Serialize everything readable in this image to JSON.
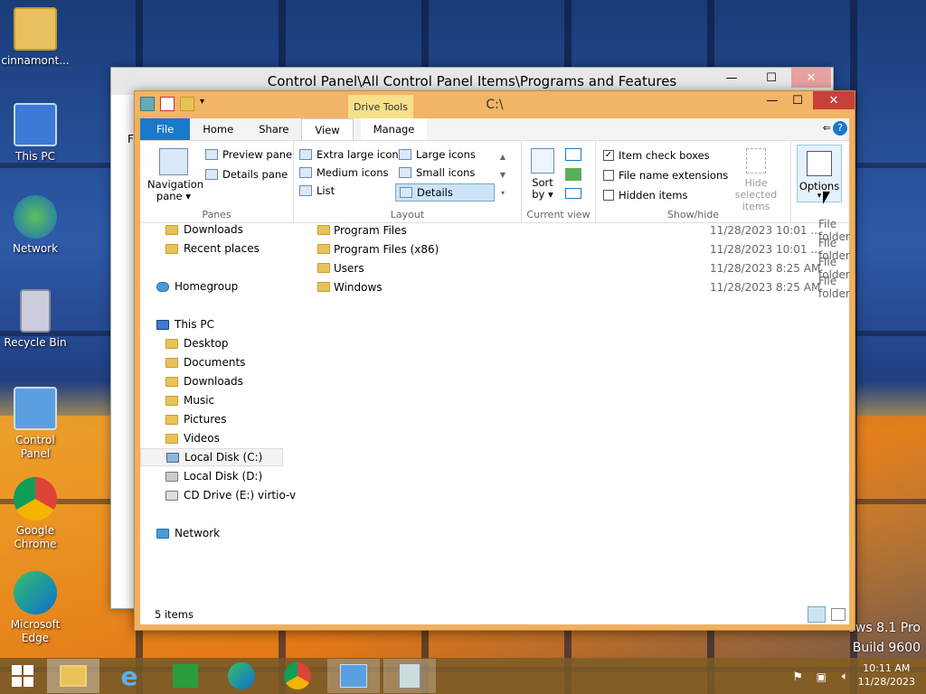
{
  "desktop": {
    "icons": [
      {
        "label": "cinnamont..."
      },
      {
        "label": "This PC"
      },
      {
        "label": "Network"
      },
      {
        "label": "Recycle Bin"
      },
      {
        "label": "Control Panel"
      },
      {
        "label": "Google Chrome"
      },
      {
        "label": "Microsoft Edge"
      }
    ],
    "watermark_line1": "ows 8.1 Pro",
    "watermark_line2": "Build 9600"
  },
  "back_window": {
    "title": "Control Panel\\All Control Panel Items\\Programs and Features",
    "left_letter": "Fi"
  },
  "window": {
    "title": "C:\\",
    "context_tab": "Drive Tools",
    "tabs": [
      "File",
      "Home",
      "Share",
      "View",
      "Manage"
    ],
    "ribbon": {
      "panes": {
        "nav_line1": "Navigation",
        "nav_line2": "pane ▾",
        "preview": "Preview pane",
        "details": "Details pane",
        "label": "Panes"
      },
      "layout": {
        "items": [
          "Extra large icons",
          "Large icons",
          "Medium icons",
          "Small icons",
          "List",
          "Details"
        ],
        "label": "Layout"
      },
      "current_view": {
        "sort_line1": "Sort",
        "sort_line2": "by ▾",
        "label": "Current view"
      },
      "showhide": {
        "item_check": "Item check boxes",
        "ext": "File name extensions",
        "hidden": "Hidden items",
        "hide_sel_1": "Hide selected",
        "hide_sel_2": "items",
        "label": "Show/hide",
        "item_check_checked": true
      },
      "options": "Options"
    },
    "nav": [
      {
        "label": "Downloads"
      },
      {
        "label": "Recent places"
      },
      {
        "label": "Homegroup"
      },
      {
        "label": "This PC"
      },
      {
        "label": "Desktop"
      },
      {
        "label": "Documents"
      },
      {
        "label": "Downloads"
      },
      {
        "label": "Music"
      },
      {
        "label": "Pictures"
      },
      {
        "label": "Videos"
      },
      {
        "label": "Local Disk (C:)"
      },
      {
        "label": "Local Disk (D:)"
      },
      {
        "label": "CD Drive (E:) virtio-v"
      },
      {
        "label": "Network"
      }
    ],
    "rows": [
      {
        "name": "Program Files",
        "date": "11/28/2023 10:01 ...",
        "type": "File folder"
      },
      {
        "name": "Program Files (x86)",
        "date": "11/28/2023 10:01 ...",
        "type": "File folder"
      },
      {
        "name": "Users",
        "date": "11/28/2023 8:25 AM",
        "type": "File folder"
      },
      {
        "name": "Windows",
        "date": "11/28/2023 8:25 AM",
        "type": "File folder"
      }
    ],
    "status": "5 items"
  },
  "taskbar": {
    "time": "10:11 AM",
    "date": "11/28/2023"
  }
}
